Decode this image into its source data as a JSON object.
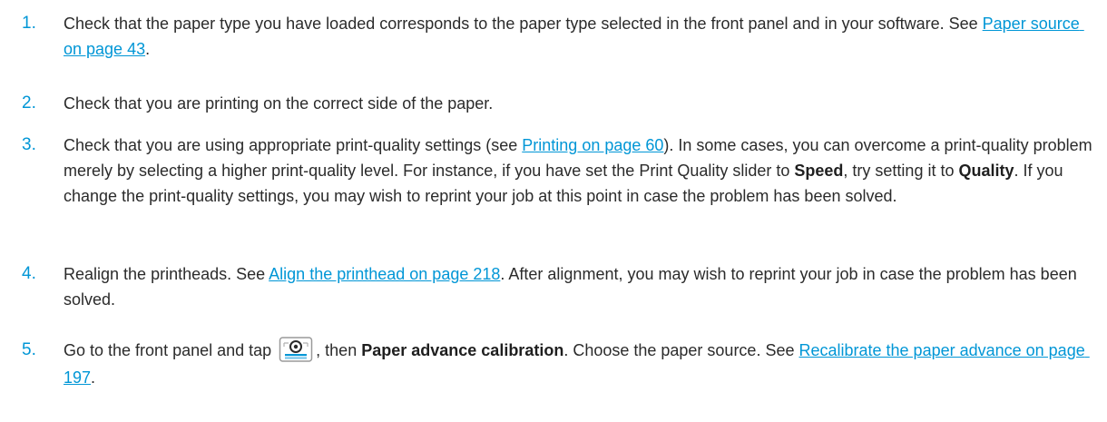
{
  "steps": [
    {
      "number": "1.",
      "parts": [
        "Check that the paper type you have loaded corresponds to the paper type selected in the front panel and in your software. See ",
        "Paper source on page 43",
        "."
      ]
    },
    {
      "number": "2.",
      "parts": [
        "Check that you are printing on the correct side of the paper."
      ]
    },
    {
      "number": "3.",
      "parts": [
        "Check that you are using appropriate print-quality settings (see ",
        "Printing on page 60",
        "). In some cases, you can overcome a print-quality problem merely by selecting a higher print-quality level. For instance, if you have set the Print Quality slider to ",
        "Speed",
        ", try setting it to ",
        "Quality",
        ". If you change the print-quality settings, you may wish to reprint your job at this point in case the problem has been solved."
      ]
    },
    {
      "number": "4.",
      "parts": [
        "Realign the printheads. See ",
        "Align the printhead on page 218",
        ". After alignment, you may wish to reprint your job in case the problem has been solved."
      ]
    },
    {
      "number": "5.",
      "parts": [
        "Go to the front panel and tap ",
        ", then ",
        "Paper advance calibration",
        ". Choose the paper source. See ",
        "Recalibrate the paper advance on page 197",
        "."
      ],
      "icon": "paper-advance-calibration-icon"
    }
  ],
  "colors": {
    "accent": "#0096d6",
    "text": "#2b2b2b"
  }
}
